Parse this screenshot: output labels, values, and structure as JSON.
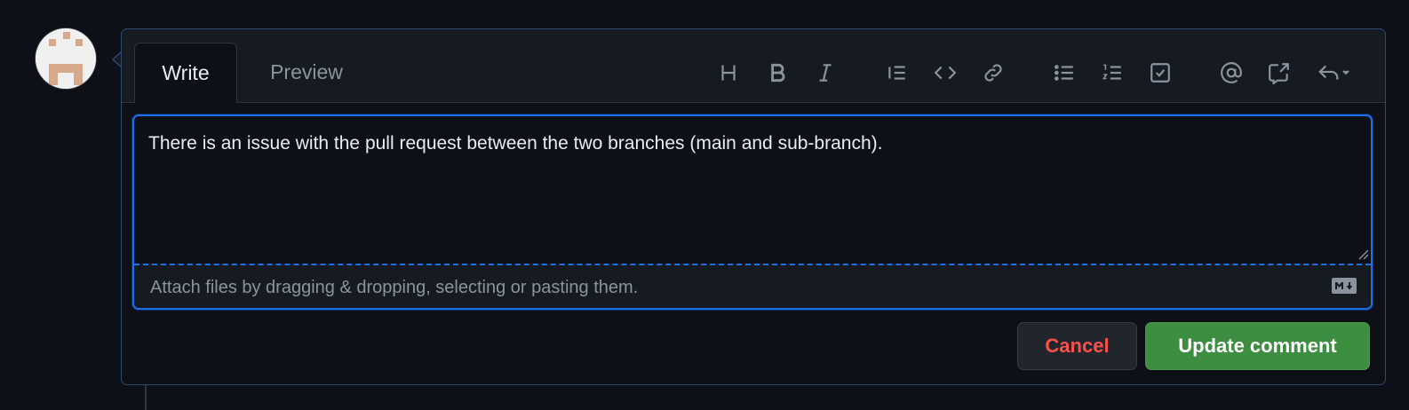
{
  "editor": {
    "tabs": [
      {
        "label": "Write",
        "active": true
      },
      {
        "label": "Preview",
        "active": false
      }
    ],
    "toolbar": [
      {
        "icon": "heading-icon"
      },
      {
        "icon": "bold-icon"
      },
      {
        "icon": "italic-icon"
      },
      {
        "icon": "quote-icon"
      },
      {
        "icon": "code-icon"
      },
      {
        "icon": "link-icon"
      },
      {
        "icon": "unordered-list-icon"
      },
      {
        "icon": "ordered-list-icon"
      },
      {
        "icon": "task-list-icon"
      },
      {
        "icon": "mention-icon"
      },
      {
        "icon": "cross-reference-icon"
      },
      {
        "icon": "saved-replies-icon"
      }
    ],
    "text": "There is an issue with the pull request between the two branches (main and sub-branch).",
    "attach_hint": "Attach files by dragging & dropping, selecting or pasting them."
  },
  "actions": {
    "cancel_label": "Cancel",
    "update_label": "Update comment"
  },
  "colors": {
    "accent": "#1f6feb",
    "cancel_text": "#f85149",
    "update_bg": "#3e8e41"
  }
}
